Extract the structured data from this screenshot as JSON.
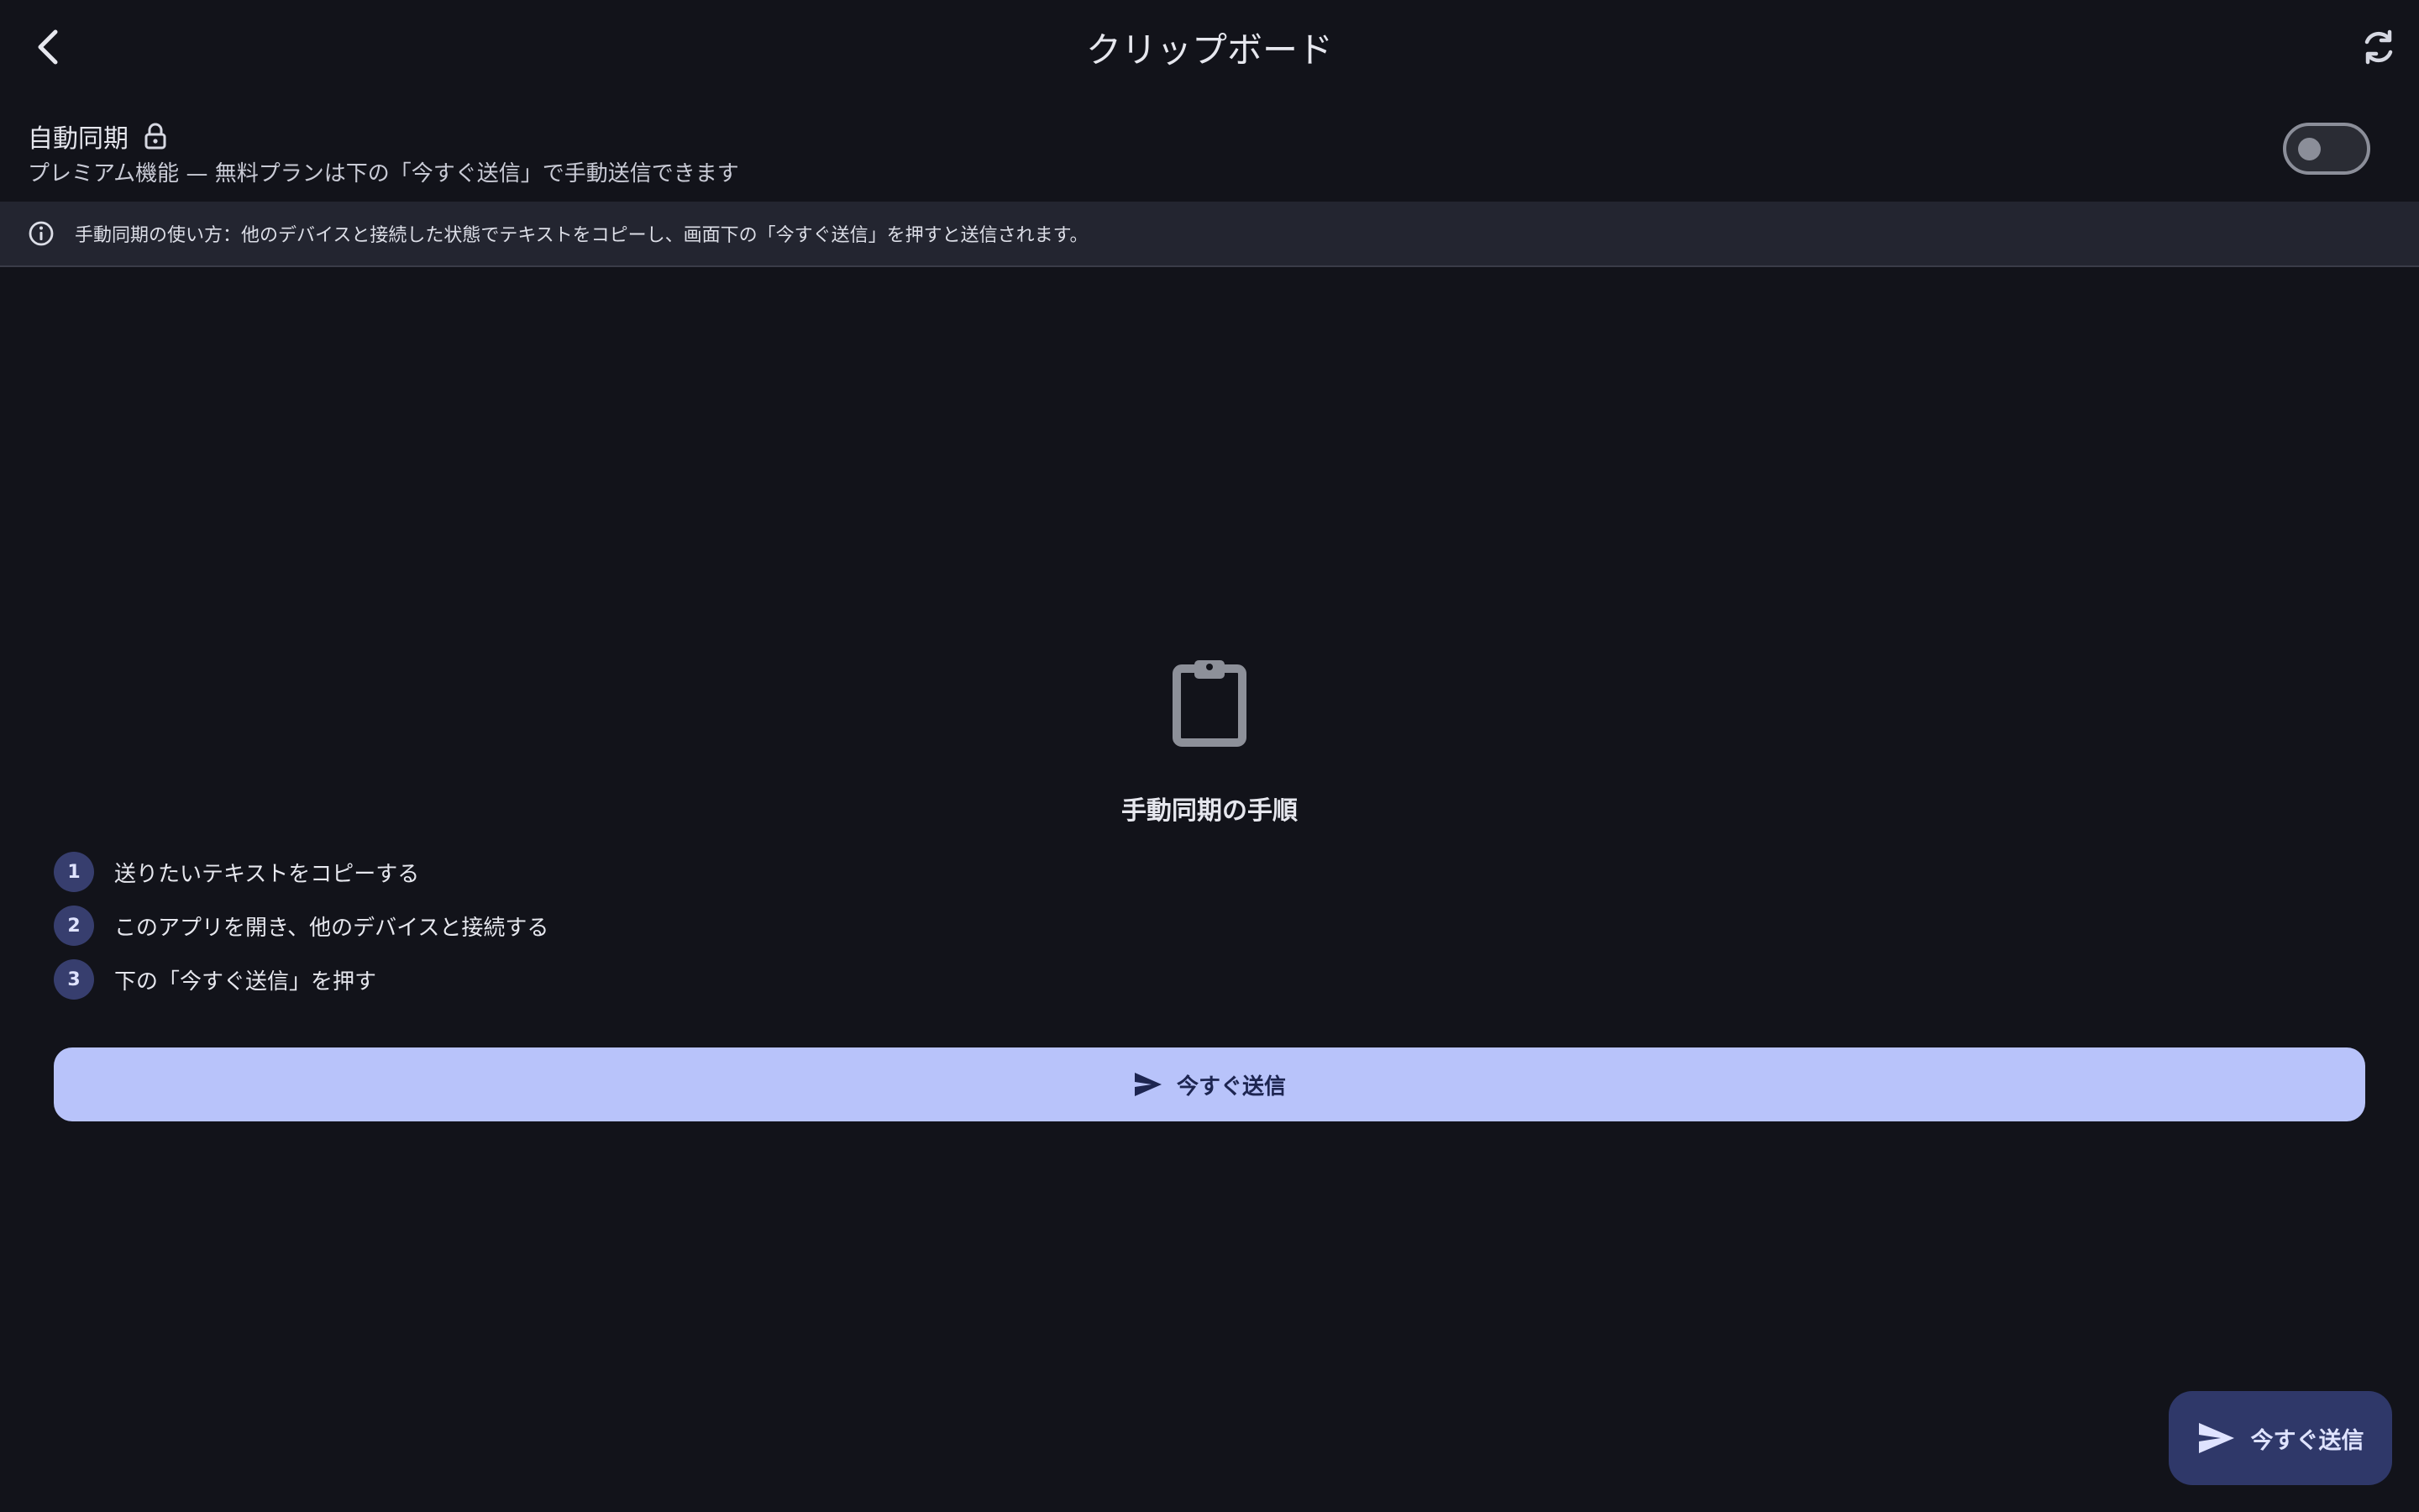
{
  "header": {
    "title": "クリップボード",
    "back_icon": "chevron-left-icon",
    "sync_icon": "sync-icon"
  },
  "auto_sync": {
    "title": "自動同期",
    "lock_icon": "lock-icon",
    "subtitle": "プレミアム機能 — 無料プランは下の「今すぐ送信」で手動送信できます",
    "toggle_on": false
  },
  "info_banner": {
    "icon": "info-icon",
    "text": "手動同期の使い方：他のデバイスと接続した状態でテキストをコピーし、画面下の「今すぐ送信」を押すと送信されます。"
  },
  "empty_state": {
    "icon": "clipboard-icon",
    "title": "手動同期の手順",
    "steps": [
      {
        "number": "1",
        "text": "送りたいテキストをコピーする"
      },
      {
        "number": "2",
        "text": "このアプリを開き、他のデバイスと接続する"
      },
      {
        "number": "3",
        "text": "下の「今すぐ送信」を押す"
      }
    ]
  },
  "send_button": {
    "label": "今すぐ送信",
    "icon": "send-icon"
  },
  "fab": {
    "label": "今すぐ送信",
    "icon": "send-icon"
  },
  "colors": {
    "background": "#12131a",
    "info_bar": "#232530",
    "primary_button": "#b8c3fa",
    "fab": "#2f3869",
    "step_badge": "#373e6e"
  }
}
